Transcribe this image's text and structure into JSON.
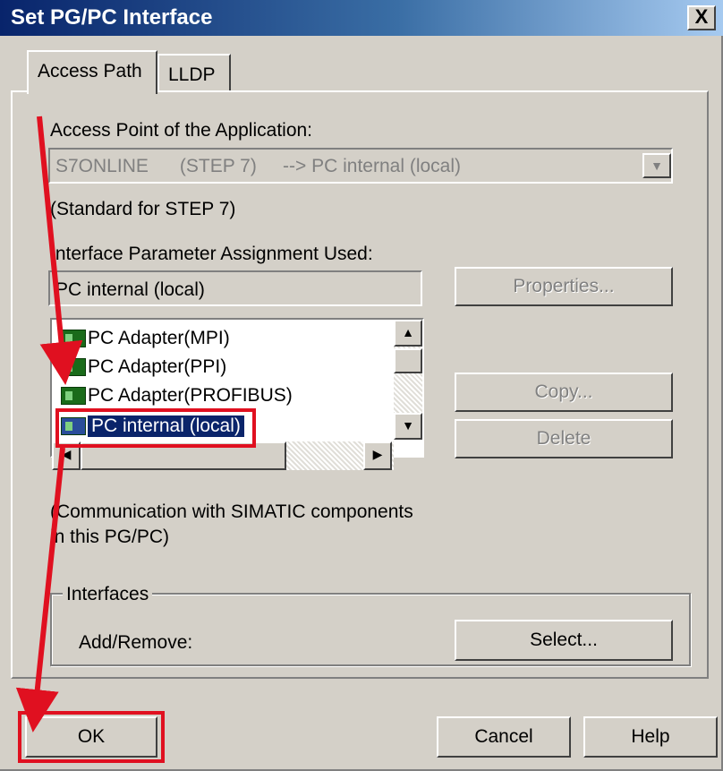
{
  "window": {
    "title": "Set PG/PC Interface",
    "close_label": "X"
  },
  "tabs": [
    {
      "label": "Access Path"
    },
    {
      "label": "LLDP"
    }
  ],
  "access_point": {
    "label": "Access Point of the Application:",
    "value": "S7ONLINE      (STEP 7)     --> PC internal (local)",
    "note": "(Standard for STEP 7)"
  },
  "interface_param": {
    "label": "Interface Parameter Assignment Used:",
    "value": "PC internal (local)",
    "properties_label": "Properties..."
  },
  "interface_list": {
    "items": [
      {
        "label": "PC Adapter(MPI)",
        "icon": "network-adapter-icon"
      },
      {
        "label": "PC Adapter(PPI)",
        "icon": "network-adapter-icon"
      },
      {
        "label": "PC Adapter(PROFIBUS)",
        "icon": "network-adapter-icon"
      },
      {
        "label": "PC internal (local)",
        "icon": "network-adapter-icon",
        "selected": true
      }
    ]
  },
  "actions": {
    "copy_label": "Copy...",
    "delete_label": "Delete"
  },
  "description": {
    "line1": "(Communication with SIMATIC components",
    "line2": "in this PG/PC)"
  },
  "interfaces_group": {
    "title": "Interfaces",
    "add_remove_label": "Add/Remove:",
    "select_label": "Select..."
  },
  "footer": {
    "ok_label": "OK",
    "cancel_label": "Cancel",
    "help_label": "Help"
  },
  "annotations": {
    "highlight_color": "#e01020"
  }
}
